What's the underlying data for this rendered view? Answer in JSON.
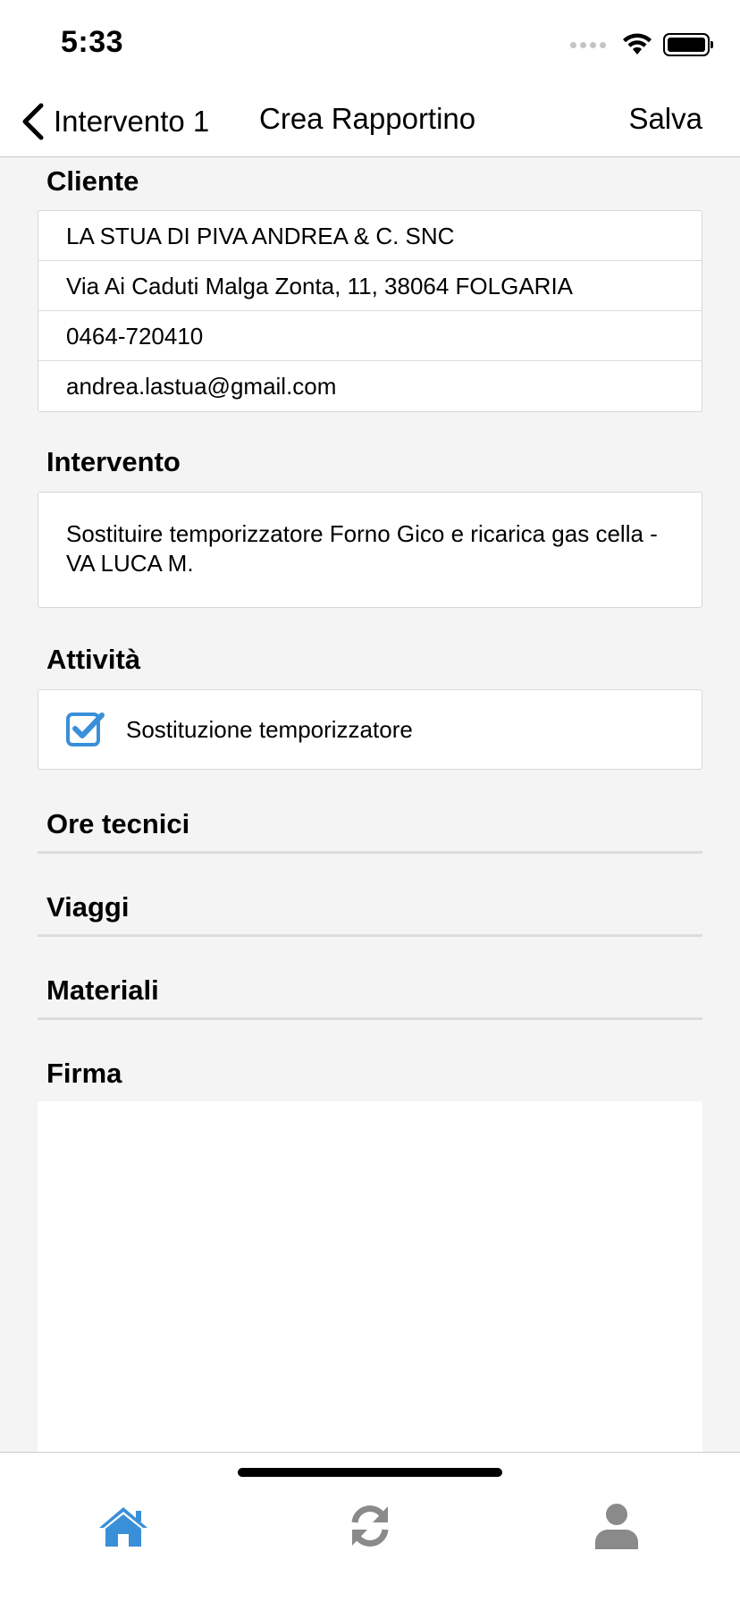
{
  "status_bar": {
    "time": "5:33"
  },
  "nav": {
    "back_label": "Intervento 1",
    "title": "Crea Rapportino",
    "save_label": "Salva"
  },
  "cliente": {
    "title": "Cliente",
    "rows": [
      "LA STUA DI PIVA ANDREA & C. SNC",
      "Via Ai Caduti Malga Zonta, 11, 38064 FOLGARIA",
      "0464-720410",
      "andrea.lastua@gmail.com"
    ]
  },
  "intervento": {
    "title": "Intervento",
    "description": "Sostituire temporizzatore Forno Gico e ricarica gas cella - VA LUCA M."
  },
  "attivita": {
    "title": "Attività",
    "items": [
      {
        "label": "Sostituzione temporizzatore",
        "checked": true
      }
    ]
  },
  "sections": {
    "ore_tecnici": "Ore tecnici",
    "viaggi": "Viaggi",
    "materiali": "Materiali",
    "firma": "Firma"
  },
  "tab_bar": {
    "items": [
      {
        "icon": "home-icon",
        "active": true
      },
      {
        "icon": "sync-icon",
        "active": false
      },
      {
        "icon": "user-icon",
        "active": false
      }
    ]
  },
  "colors": {
    "accent": "#3a8fd9",
    "inactive_icon": "#8a8a8a",
    "background": "#f4f4f4"
  }
}
